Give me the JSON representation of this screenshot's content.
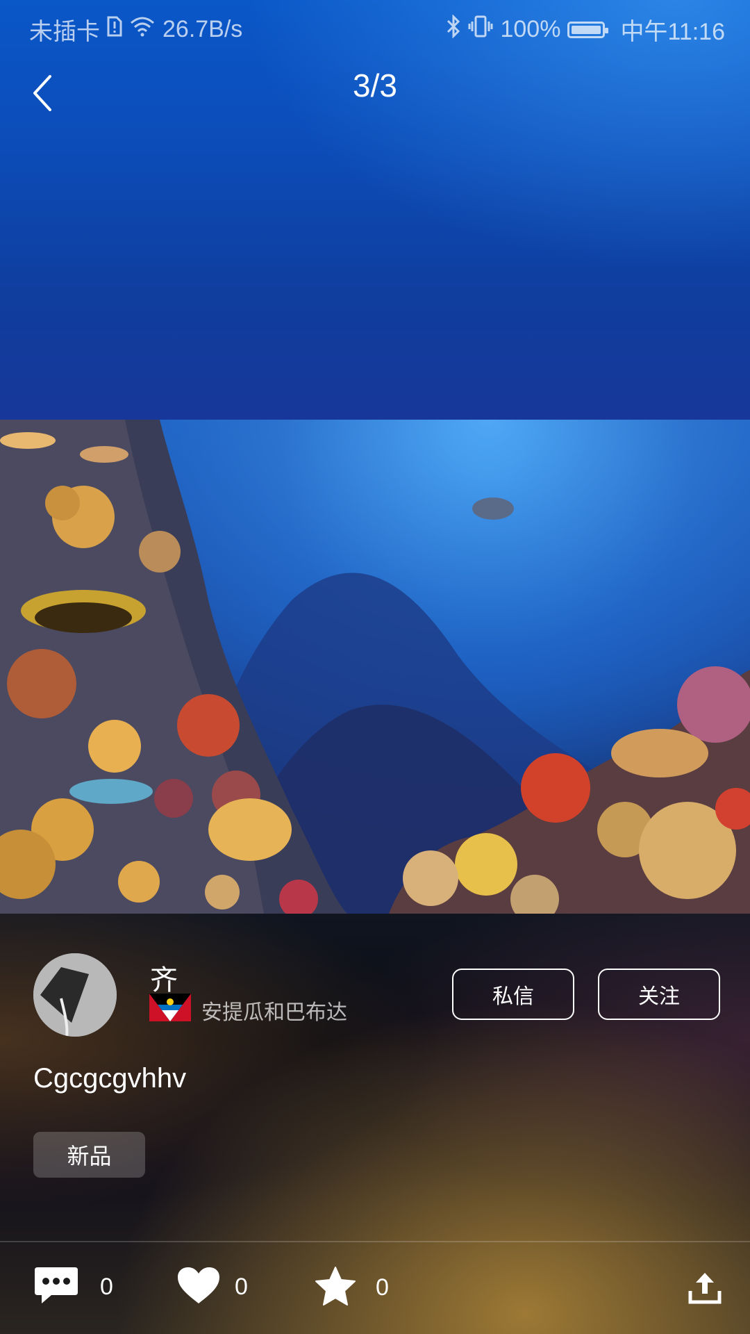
{
  "status_bar": {
    "carrier": "未插卡",
    "speed": "26.7B/s",
    "battery": "100%",
    "time": "中午11:16"
  },
  "header": {
    "page_counter": "3/3"
  },
  "post": {
    "username": "齐",
    "country": "安提瓜和巴布达",
    "text": "Cgcgcgvhhv",
    "tag": "新品"
  },
  "buttons": {
    "message": "私信",
    "follow": "关注"
  },
  "actions": {
    "comments": "0",
    "likes": "0",
    "favorites": "0"
  },
  "icons": [
    "back-icon",
    "comment-icon",
    "heart-icon",
    "star-icon",
    "share-icon",
    "wifi-icon",
    "bluetooth-icon",
    "vibrate-icon",
    "battery-icon",
    "sim-alert-icon"
  ]
}
